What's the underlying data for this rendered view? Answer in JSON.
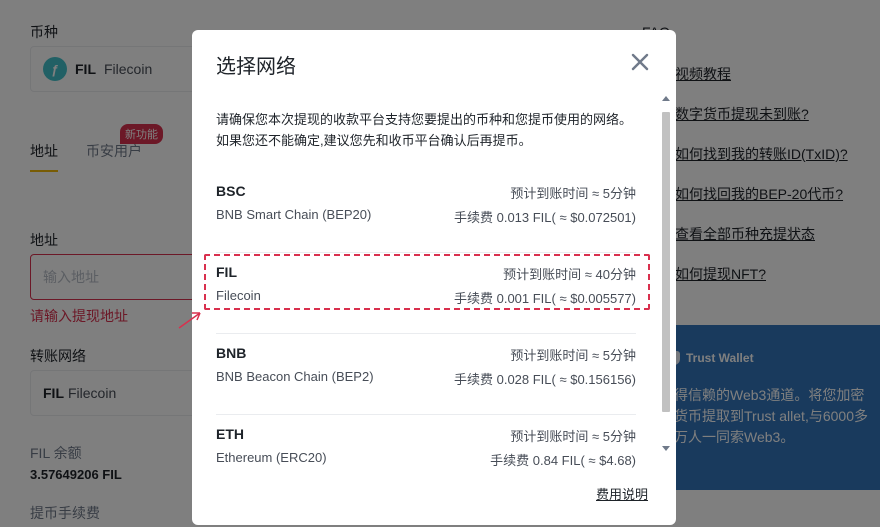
{
  "background": {
    "coin_label": "币种",
    "coin": {
      "code": "FIL",
      "name": "Filecoin",
      "icon": "filecoin-logo"
    },
    "tabs": [
      {
        "label": "地址"
      },
      {
        "label": "币安用户"
      }
    ],
    "new_badge": "新功能",
    "address_label": "地址",
    "address_placeholder": "输入地址",
    "address_error": "请输入提现地址",
    "network_label": "转账网络",
    "network_selected": {
      "code": "FIL",
      "name": "Filecoin"
    },
    "balance_label": "FIL 余额",
    "balance_value": "3.57649206 FIL",
    "fee_label": "提币手续费",
    "faq_title": "FAQ",
    "faq_links": [
      "视频教程",
      "数字货币提现未到账?",
      "如何找到我的转账ID(TxID)?",
      "如何找回我的BEP-20代币?",
      "查看全部币种充提状态",
      "如何提现NFT?"
    ],
    "banner": {
      "brand": "Trust Wallet",
      "text": "得信赖的Web3通道。将您加密货币提取到Trust allet,与6000多万人一同索Web3。"
    }
  },
  "modal": {
    "title": "选择网络",
    "notice": "请确保您本次提现的收款平台支持您要提出的币种和您提币使用的网络。如果您还不能确定,建议您先和收币平台确认后再提币。",
    "networks": [
      {
        "code": "BSC",
        "name": "BNB Smart Chain (BEP20)",
        "eta": "预计到账时间 ≈ 5分钟",
        "fee": "手续费 0.013 FIL( ≈ $0.072501)"
      },
      {
        "code": "FIL",
        "name": "Filecoin",
        "eta": "预计到账时间 ≈ 40分钟",
        "fee": "手续费 0.001 FIL( ≈ $0.005577)"
      },
      {
        "code": "BNB",
        "name": "BNB Beacon Chain (BEP2)",
        "eta": "预计到账时间 ≈ 5分钟",
        "fee": "手续费 0.028 FIL( ≈ $0.156156)"
      },
      {
        "code": "ETH",
        "name": "Ethereum (ERC20)",
        "eta": "预计到账时间 ≈ 5分钟",
        "fee": "手续费 0.84 FIL( ≈ $4.68)"
      }
    ],
    "fee_help": "费用说明",
    "highlight_color": "#d9304e"
  }
}
